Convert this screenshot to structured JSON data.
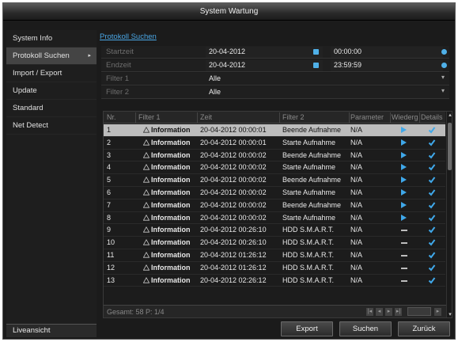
{
  "window": {
    "title": "System Wartung"
  },
  "sidebar": {
    "items": [
      {
        "label": "System Info",
        "active": false
      },
      {
        "label": "Protokoll Suchen",
        "active": true,
        "arrow": "▸"
      },
      {
        "label": "Import / Export",
        "active": false
      },
      {
        "label": "Update",
        "active": false
      },
      {
        "label": "Standard",
        "active": false
      },
      {
        "label": "Net Detect",
        "active": false
      }
    ],
    "live_view": "Liveansicht"
  },
  "panel": {
    "title": "Protokoll Suchen",
    "fields": {
      "start": {
        "label": "Startzeit",
        "date": "20-04-2012",
        "time": "00:00:00"
      },
      "end": {
        "label": "Endzeit",
        "date": "20-04-2012",
        "time": "23:59:59"
      },
      "filter1": {
        "label": "Filter 1",
        "value": "Alle"
      },
      "filter2": {
        "label": "Filter 2",
        "value": "Alle"
      }
    }
  },
  "table": {
    "columns": [
      "Nr.",
      "Filter 1",
      "Zeit",
      "Filter 2",
      "Parameter",
      "Wiedergabe",
      "Details"
    ],
    "rows": [
      {
        "nr": "1",
        "f1": "Information",
        "time": "20-04-2012 00:00:01",
        "f2": "Beende Aufnahme",
        "param": "N/A",
        "play": true,
        "selected": true
      },
      {
        "nr": "2",
        "f1": "Information",
        "time": "20-04-2012 00:00:01",
        "f2": "Starte Aufnahme",
        "param": "N/A",
        "play": true,
        "selected": false
      },
      {
        "nr": "3",
        "f1": "Information",
        "time": "20-04-2012 00:00:02",
        "f2": "Beende Aufnahme",
        "param": "N/A",
        "play": true,
        "selected": false
      },
      {
        "nr": "4",
        "f1": "Information",
        "time": "20-04-2012 00:00:02",
        "f2": "Starte Aufnahme",
        "param": "N/A",
        "play": true,
        "selected": false
      },
      {
        "nr": "5",
        "f1": "Information",
        "time": "20-04-2012 00:00:02",
        "f2": "Beende Aufnahme",
        "param": "N/A",
        "play": true,
        "selected": false
      },
      {
        "nr": "6",
        "f1": "Information",
        "time": "20-04-2012 00:00:02",
        "f2": "Starte Aufnahme",
        "param": "N/A",
        "play": true,
        "selected": false
      },
      {
        "nr": "7",
        "f1": "Information",
        "time": "20-04-2012 00:00:02",
        "f2": "Beende Aufnahme",
        "param": "N/A",
        "play": true,
        "selected": false
      },
      {
        "nr": "8",
        "f1": "Information",
        "time": "20-04-2012 00:00:02",
        "f2": "Starte Aufnahme",
        "param": "N/A",
        "play": true,
        "selected": false
      },
      {
        "nr": "9",
        "f1": "Information",
        "time": "20-04-2012 00:26:10",
        "f2": "HDD S.M.A.R.T.",
        "param": "N/A",
        "play": false,
        "selected": false
      },
      {
        "nr": "10",
        "f1": "Information",
        "time": "20-04-2012 00:26:10",
        "f2": "HDD S.M.A.R.T.",
        "param": "N/A",
        "play": false,
        "selected": false
      },
      {
        "nr": "11",
        "f1": "Information",
        "time": "20-04-2012 01:26:12",
        "f2": "HDD S.M.A.R.T.",
        "param": "N/A",
        "play": false,
        "selected": false
      },
      {
        "nr": "12",
        "f1": "Information",
        "time": "20-04-2012 01:26:12",
        "f2": "HDD S.M.A.R.T.",
        "param": "N/A",
        "play": false,
        "selected": false
      },
      {
        "nr": "13",
        "f1": "Information",
        "time": "20-04-2012 02:26:12",
        "f2": "HDD S.M.A.R.T.",
        "param": "N/A",
        "play": false,
        "selected": false
      }
    ],
    "total": "Gesamt: 58 P: 1/4",
    "pager": [
      "|◂",
      "◂",
      "▸",
      "▸|"
    ],
    "page_go": "▸"
  },
  "buttons": {
    "export": "Export",
    "search": "Suchen",
    "back": "Zurück"
  },
  "colors": {
    "accent": "#4aa7e6",
    "selected_row": "#bdbdbd",
    "background": "#1b1b1b"
  },
  "icons": {
    "row_type": "warning-triangle-icon",
    "play": "play-icon",
    "details": "checkmark-icon",
    "calendar": "calendar-icon",
    "clock": "clock-icon"
  }
}
